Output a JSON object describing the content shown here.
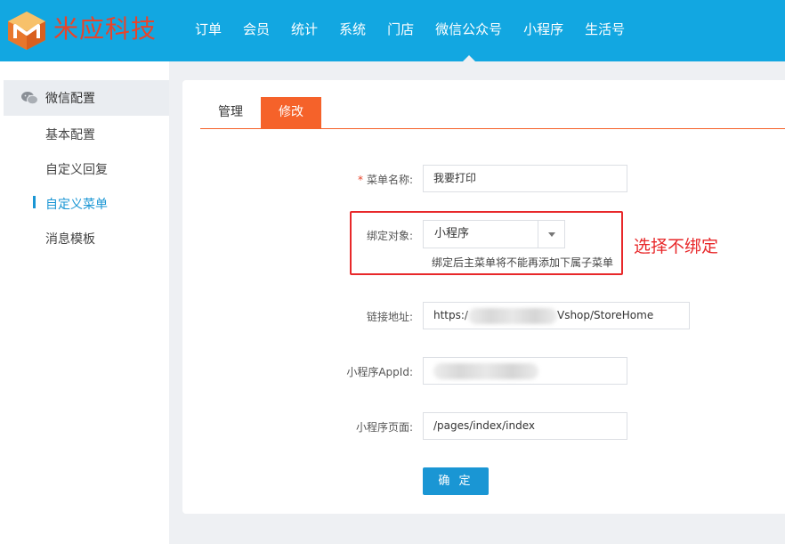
{
  "brand": {
    "name": "米应科技",
    "logo_icon": "cube-logo-icon"
  },
  "nav": {
    "items": [
      "订单",
      "会员",
      "统计",
      "系统",
      "门店",
      "微信公众号",
      "小程序",
      "生活号"
    ],
    "active": "微信公众号"
  },
  "sidebar": {
    "section_icon": "wechat-icon",
    "section_title": "微信配置",
    "items": [
      "基本配置",
      "自定义回复",
      "自定义菜单",
      "消息模板"
    ],
    "active": "自定义菜单"
  },
  "tabs": {
    "manage": "管理",
    "edit": "修改",
    "active": "修改"
  },
  "form": {
    "required_mark": "*",
    "menu_name": {
      "label": "菜单名称:",
      "value": "我要打印"
    },
    "bind_target": {
      "label": "绑定对象:",
      "value": "小程序",
      "help": "绑定后主菜单将不能再添加下属子菜单"
    },
    "link_url": {
      "label": "链接地址:",
      "prefix": "https:/",
      "suffix": "Vshop/StoreHome"
    },
    "appid": {
      "label": "小程序AppId:"
    },
    "page": {
      "label": "小程序页面:",
      "value": "/pages/index/index"
    },
    "submit": "确 定"
  },
  "annotation": {
    "text": "选择不绑定"
  },
  "colors": {
    "topbar": "#12a7e1",
    "brand": "#e8442a",
    "accent": "#f5622a",
    "primary": "#1a96d4",
    "annotation": "#e8282a"
  }
}
